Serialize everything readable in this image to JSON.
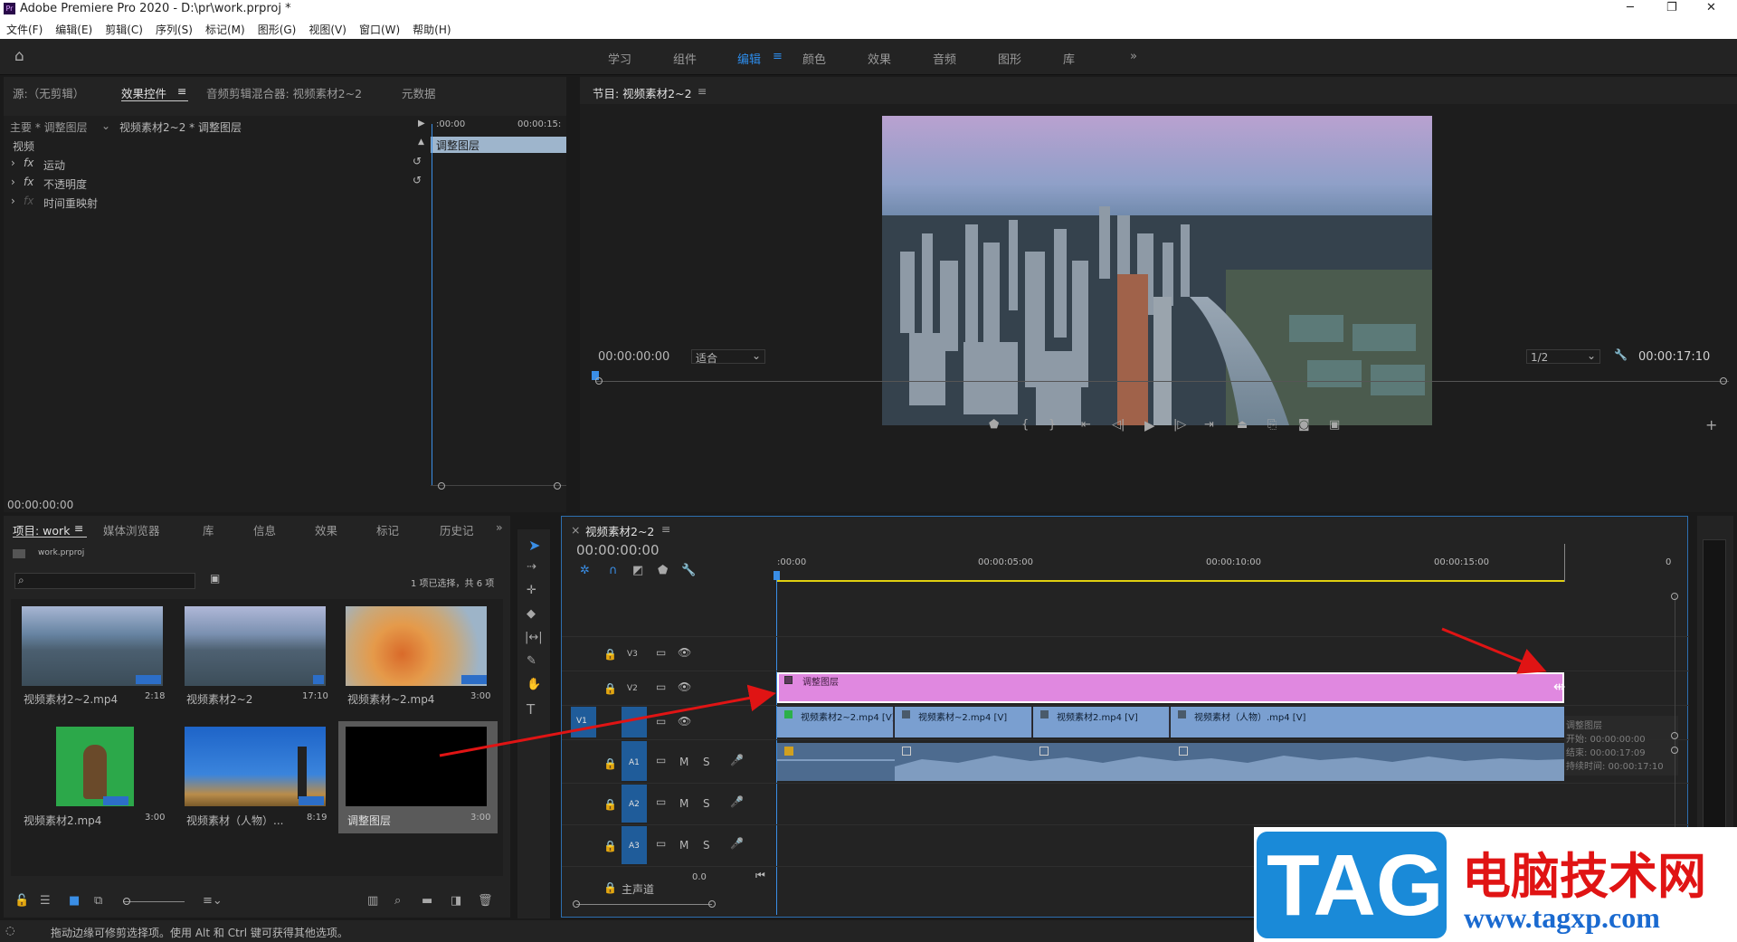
{
  "titlebar": {
    "app_title": "Adobe Premiere Pro 2020 - D:\\pr\\work.prproj *",
    "minimize": "─",
    "maximize": "❐",
    "close": "✕"
  },
  "menu": [
    "文件(F)",
    "编辑(E)",
    "剪辑(C)",
    "序列(S)",
    "标记(M)",
    "图形(G)",
    "视图(V)",
    "窗口(W)",
    "帮助(H)"
  ],
  "workspaces": [
    "学习",
    "组件",
    "编辑",
    "颜色",
    "效果",
    "音频",
    "图形",
    "库"
  ],
  "active_workspace": "编辑",
  "effects_panel": {
    "tabs": [
      "源:（无剪辑）",
      "效果控件",
      "音频剪辑混合器: 视频素材2~2",
      "元数据"
    ],
    "master": "主要 * 调整图层",
    "clip": "视频素材2~2 * 调整图层",
    "section": "视频",
    "items": [
      "运动",
      "不透明度",
      "时间重映射"
    ],
    "time_start": ":00:00",
    "time_end": "00:00:15:",
    "layer_label": "调整图层",
    "timecode": "00:00:00:00"
  },
  "program_monitor": {
    "title": "节目: 视频素材2~2",
    "timecode": "00:00:00:00",
    "fit": "适合",
    "resolution": "1/2",
    "duration": "00:00:17:10"
  },
  "project_panel": {
    "tabs": [
      "项目: work",
      "媒体浏览器",
      "库",
      "信息",
      "效果",
      "标记",
      "历史记"
    ],
    "project_file": "work.prproj",
    "selection": "1 项已选择，共 6 项",
    "items": [
      {
        "name": "视频素材2~2.mp4",
        "duration": "2:18"
      },
      {
        "name": "视频素材2~2",
        "duration": "17:10"
      },
      {
        "name": "视频素材~2.mp4",
        "duration": "3:00"
      },
      {
        "name": "视频素材2.mp4",
        "duration": "3:00"
      },
      {
        "name": "视频素材（人物）...",
        "duration": "8:19"
      },
      {
        "name": "调整图层",
        "duration": "3:00"
      }
    ]
  },
  "timeline": {
    "title": "视频素材2~2",
    "timecode": "00:00:00:00",
    "ruler": [
      ":00:00",
      "00:00:05:00",
      "00:00:10:00",
      "00:00:15:00",
      "0"
    ],
    "tracks": [
      "V3",
      "V2",
      "V1",
      "A1",
      "A2",
      "A3"
    ],
    "master": "主声道",
    "master_value": "0.0",
    "adjust_clip": "调整图层",
    "video_clips": [
      "视频素材2~2.mp4 [V]",
      "视频素材~2.mp4 [V]",
      "视频素材2.mp4 [V]",
      "视频素材（人物）.mp4 [V]"
    ],
    "tooltip": {
      "name": "调整图层",
      "start": "开始: 00:00:00:00",
      "end": "结束: 00:00:17:09",
      "duration": "持续时间: 00:00:17:10"
    }
  },
  "status_bar": "拖动边缘可修剪选择项。使用 Alt 和 Ctrl 键可获得其他选项。",
  "watermark": {
    "tag": "TAG",
    "site_name": "电脑技术网",
    "url": "www.tagxp.com"
  },
  "colors": {
    "accent": "#2d8ceb",
    "adjust_clip": "#e088e0",
    "video_clip": "#7a9fd0",
    "audio_clip": "#4d6b8f",
    "playhead": "#3a8ee6"
  }
}
